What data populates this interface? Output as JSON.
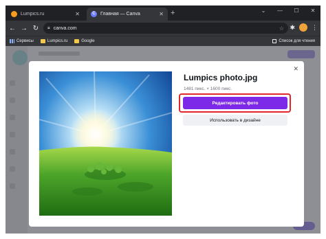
{
  "browser": {
    "tabs": [
      {
        "label": "Lumpics.ru",
        "active": false
      },
      {
        "label": "Главная — Canva",
        "active": true
      }
    ],
    "new_tab": "+",
    "window_controls": [
      "⌄",
      "—",
      "☐",
      "✕"
    ],
    "url": "canva.com",
    "bookmarks": [
      {
        "label": "Сервисы",
        "icon": "apps-icon"
      },
      {
        "label": "Lumpics.ru",
        "icon": "folder-icon"
      },
      {
        "label": "Google",
        "icon": "folder-icon"
      }
    ],
    "reading_list": "Список для чтения"
  },
  "modal": {
    "title": "Lumpics photo.jpg",
    "size": "1481 пикс. × 1600 пикс.",
    "edit_button": "Редактировать фото",
    "use_button": "Использовать в дизайне",
    "accent_color": "#7d2ae8",
    "highlight_color": "#e0262b"
  }
}
